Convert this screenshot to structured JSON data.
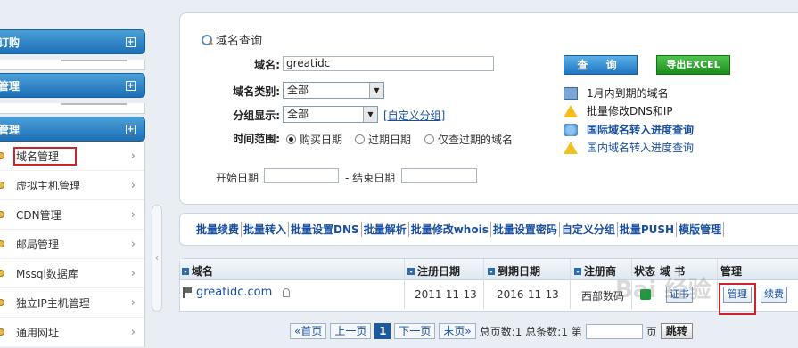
{
  "sidebar": {
    "groups": [
      {
        "title": "订购",
        "plus": "+"
      },
      {
        "title": "管理",
        "plus": "+"
      },
      {
        "title": "管理",
        "plus": "+"
      }
    ],
    "items": [
      {
        "label": "域名管理",
        "arrow": "›"
      },
      {
        "label": "虚拟主机管理",
        "arrow": "›"
      },
      {
        "label": "CDN管理",
        "arrow": "›"
      },
      {
        "label": "邮局管理",
        "arrow": "›"
      },
      {
        "label": "Mssql数据库",
        "arrow": "›"
      },
      {
        "label": "独立IP主机管理",
        "arrow": "›"
      },
      {
        "label": "通用网址",
        "arrow": "›"
      }
    ],
    "collapse": "‹"
  },
  "query": {
    "title": "域名查询",
    "domain_label": "域名:",
    "domain_value": "greatidc",
    "type_label": "域名类别:",
    "type_value": "全部",
    "group_label": "分组显示:",
    "group_value": "全部",
    "custom_group": "[自定义分组]",
    "time_label": "时间范围:",
    "radio_buy": "购买日期",
    "radio_expire": "过期日期",
    "radio_only_expired": "仅查过期的域名",
    "start_label": "开始日期",
    "end_label": "- 结束日期",
    "query_button": "查 询",
    "export_button": "导出EXCEL",
    "links": [
      "1月内到期的域名",
      "批量修改DNS和IP",
      "国际域名转入进度查询",
      "国内域名转入进度查询"
    ]
  },
  "batch": [
    "批量续费",
    "批量转入",
    "批量设置DNS",
    "批量解析",
    "批量修改whois",
    "批量设置密码",
    "自定义分组",
    "批量PUSH",
    "模版管理"
  ],
  "table": {
    "headers": {
      "domain": "域名",
      "reg_date": "注册日期",
      "exp_date": "到期日期",
      "registrar": "注册商",
      "status": "状态",
      "cert": "域    书",
      "manage": "管理"
    },
    "rows": [
      {
        "domain": "greatidc.com",
        "reg_date": "2011-11-13",
        "exp_date": "2016-11-13",
        "registrar": "西部数码",
        "cert_btn": "证书",
        "manage_btn": "管理",
        "renew_btn": "续费"
      }
    ]
  },
  "pager": {
    "first": "«首页",
    "prev": "上一页",
    "current": "1",
    "next": "下一页",
    "last": "末页»",
    "summary": "总页数:1 总条数:1 第",
    "page_suffix": "页",
    "jump": "跳转"
  },
  "watermark": "Bai 经验"
}
